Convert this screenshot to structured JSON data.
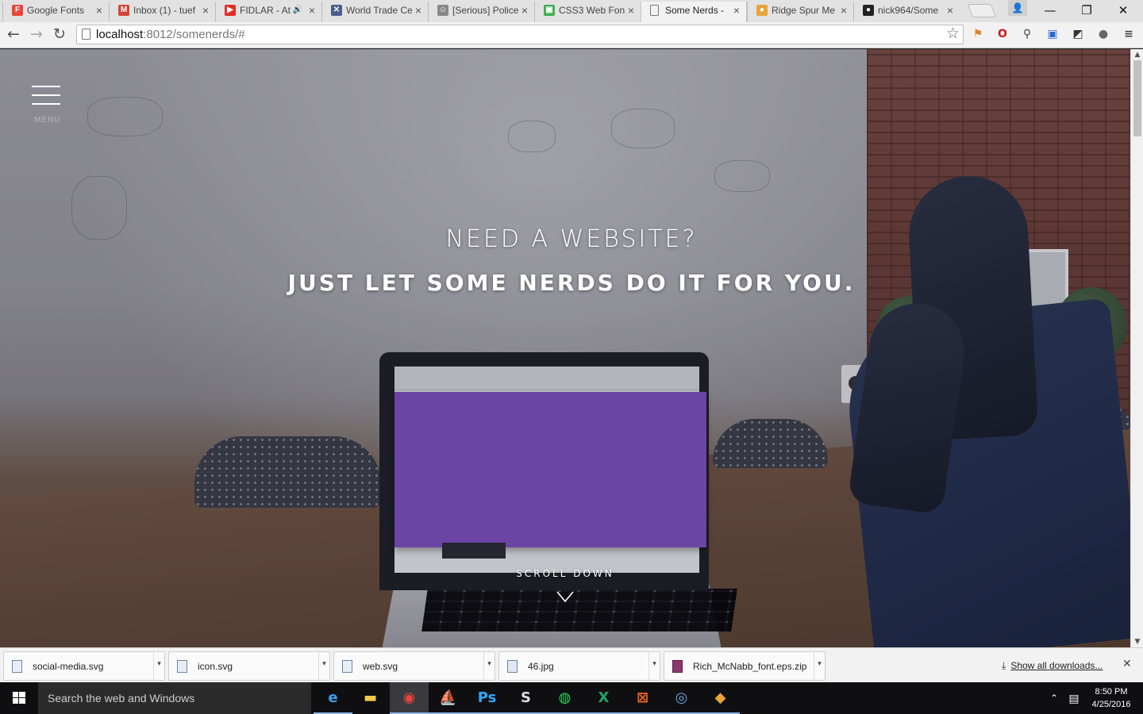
{
  "browser": {
    "tabs": [
      {
        "title": "Google Fonts",
        "favicon": "google-fonts-icon",
        "color": "#e8453c",
        "glyph": "F",
        "active": false
      },
      {
        "title": "Inbox (1) - tuef",
        "favicon": "gmail-icon",
        "color": "#d44638",
        "glyph": "M",
        "active": false
      },
      {
        "title": "FIDLAR - At",
        "favicon": "youtube-icon",
        "color": "#e52d27",
        "glyph": "▶",
        "active": false,
        "audio": true
      },
      {
        "title": "World Trade Ce",
        "favicon": "ribbon-icon",
        "color": "#4a5f8a",
        "glyph": "✕",
        "active": false
      },
      {
        "title": "[Serious] Police",
        "favicon": "reddit-icon",
        "color": "#888888",
        "glyph": "☺",
        "active": false
      },
      {
        "title": "CSS3 Web Fon",
        "favicon": "css3-icon",
        "color": "#3fae4f",
        "glyph": "▣",
        "active": false
      },
      {
        "title": "Some Nerds -",
        "favicon": "page-icon",
        "color": "#777777",
        "glyph": "",
        "active": true
      },
      {
        "title": "Ridge Spur Me",
        "favicon": "circle-icon",
        "color": "#e8a33a",
        "glyph": "●",
        "active": false
      },
      {
        "title": "nick964/Some",
        "favicon": "github-icon",
        "color": "#222222",
        "glyph": "●",
        "active": false
      }
    ],
    "url_host": "localhost",
    "url_path": ":8012/somenerds/#"
  },
  "page": {
    "menu_label": "MENU",
    "hero_line1": "NEED A WEBSITE?",
    "hero_line2_pre": "JUST LET ",
    "hero_line2_bold": "SOME NERDS",
    "hero_line2_post": " DO IT FOR YOU.",
    "scroll_label": "SCROLL DOWN"
  },
  "downloads": {
    "items": [
      {
        "name": "social-media.svg",
        "icon": "svg-file-icon"
      },
      {
        "name": "icon.svg",
        "icon": "svg-file-icon"
      },
      {
        "name": "web.svg",
        "icon": "svg-file-icon"
      },
      {
        "name": "46.jpg",
        "icon": "image-file-icon"
      },
      {
        "name": "Rich_McNabb_font.eps.zip",
        "icon": "zip-file-icon"
      }
    ],
    "show_all": "Show all downloads..."
  },
  "taskbar": {
    "search_placeholder": "Search the web and Windows",
    "time": "8:50 PM",
    "date": "4/25/2016"
  }
}
